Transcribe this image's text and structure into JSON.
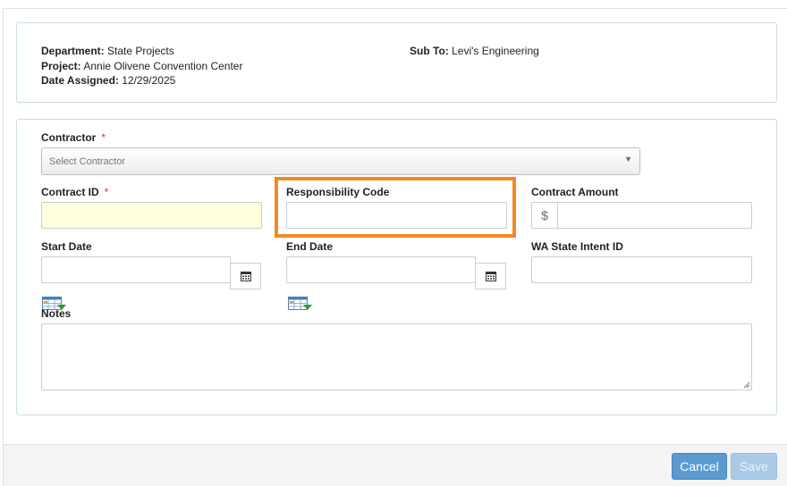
{
  "info": {
    "department_label": "Department:",
    "department_value": "State Projects",
    "project_label": "Project:",
    "project_value": "Annie Olivene Convention Center",
    "date_label": "Date Assigned:",
    "date_value": "12/29/2025",
    "subto_label": "Sub To:",
    "subto_value": "Levi's Engineering"
  },
  "form": {
    "contractor_label": "Contractor",
    "required_mark": "*",
    "contractor_placeholder": "Select Contractor",
    "contract_id_label": "Contract ID",
    "responsibility_code_label": "Responsibility Code",
    "contract_amount_label": "Contract Amount",
    "currency_symbol": "$",
    "start_date_label": "Start Date",
    "end_date_label": "End Date",
    "wa_state_intent_label": "WA State Intent ID",
    "notes_label": "Notes"
  },
  "buttons": {
    "cancel": "Cancel",
    "save": "Save"
  },
  "icons": {
    "dropdown": "chevron-down-icon",
    "calendar": "calendar-icon",
    "grid_picker": "table-grid-icon"
  },
  "colors": {
    "highlight": "#f08a24",
    "required": "#d9302c",
    "cancel_button": "#5b9bd1",
    "save_button_disabled": "#a9c9e6",
    "contract_id_bg": "#ffffe0"
  }
}
